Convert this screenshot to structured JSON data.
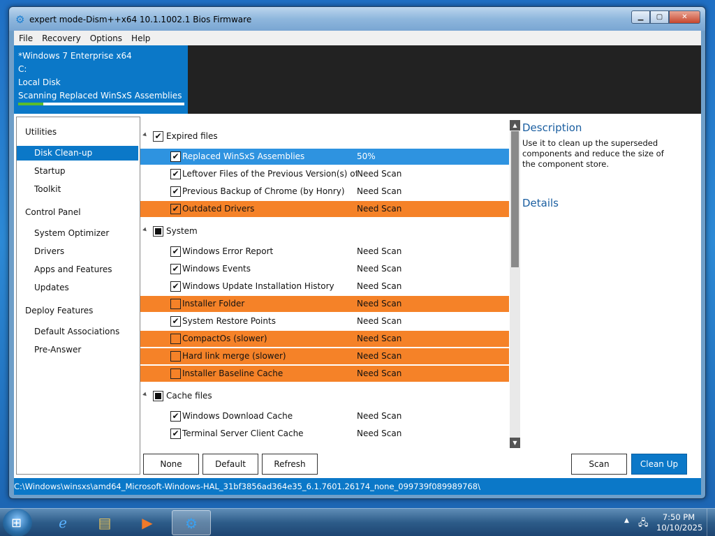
{
  "window": {
    "title": "expert mode-Dism++x64 10.1.1002.1 Bios Firmware"
  },
  "menu": [
    "File",
    "Recovery",
    "Options",
    "Help"
  ],
  "info": {
    "os": "*Windows 7 Enterprise x64",
    "drive": "C:",
    "disk": "Local Disk",
    "task": "Scanning Replaced WinSxS Assemblies",
    "progress_fraction": 0.15
  },
  "sidebar": {
    "utilities": "Utilities",
    "disk_cleanup": "Disk Clean-up",
    "startup": "Startup",
    "toolkit": "Toolkit",
    "control_panel": "Control Panel",
    "system_optimizer": "System Optimizer",
    "drivers": "Drivers",
    "apps_features": "Apps and Features",
    "updates": "Updates",
    "deploy_features": "Deploy Features",
    "default_associations": "Default Associations",
    "pre_answer": "Pre-Answer"
  },
  "groups": {
    "expired": "Expired files",
    "system": "System",
    "cache": "Cache files"
  },
  "rows": {
    "r1": {
      "label": "Replaced WinSxS Assemblies",
      "status": "50%"
    },
    "r2": {
      "label": "Leftover Files of the Previous Version(s) of Dism",
      "status": "Need Scan"
    },
    "r3": {
      "label": "Previous Backup of Chrome (by Honry)",
      "status": "Need Scan"
    },
    "r4": {
      "label": "Outdated Drivers",
      "status": "Need Scan"
    },
    "r5": {
      "label": "Windows Error Report",
      "status": "Need Scan"
    },
    "r6": {
      "label": "Windows Events",
      "status": "Need Scan"
    },
    "r7": {
      "label": "Windows Update Installation History",
      "status": "Need Scan"
    },
    "r8": {
      "label": "Installer Folder",
      "status": "Need Scan"
    },
    "r9": {
      "label": "System Restore Points",
      "status": "Need Scan"
    },
    "r10": {
      "label": "CompactOs (slower)",
      "status": "Need Scan"
    },
    "r11": {
      "label": "Hard link merge (slower)",
      "status": "Need Scan"
    },
    "r12": {
      "label": "Installer Baseline Cache",
      "status": "Need Scan"
    },
    "r13": {
      "label": "Windows Download Cache",
      "status": "Need Scan"
    },
    "r14": {
      "label": "Terminal Server Client Cache",
      "status": "Need Scan"
    }
  },
  "check": "✔",
  "description": {
    "title": "Description",
    "text": "Use it to clean up the superseded components and reduce the size of the component store.",
    "details": "Details"
  },
  "buttons": {
    "none": "None",
    "default": "Default",
    "refresh": "Refresh",
    "scan": "Scan",
    "cleanup": "Clean Up"
  },
  "statusbar": "C:\\Windows\\winsxs\\amd64_Microsoft-Windows-HAL_31bf3856ad364e35_6.1.7601.26174_none_099739f089989768\\",
  "taskbar": {
    "time": "7:50 PM",
    "date": "10/10/2025"
  },
  "colors": {
    "accent": "#0b78c8",
    "warning_row": "#f58228",
    "selected_row": "#2e93e0"
  }
}
